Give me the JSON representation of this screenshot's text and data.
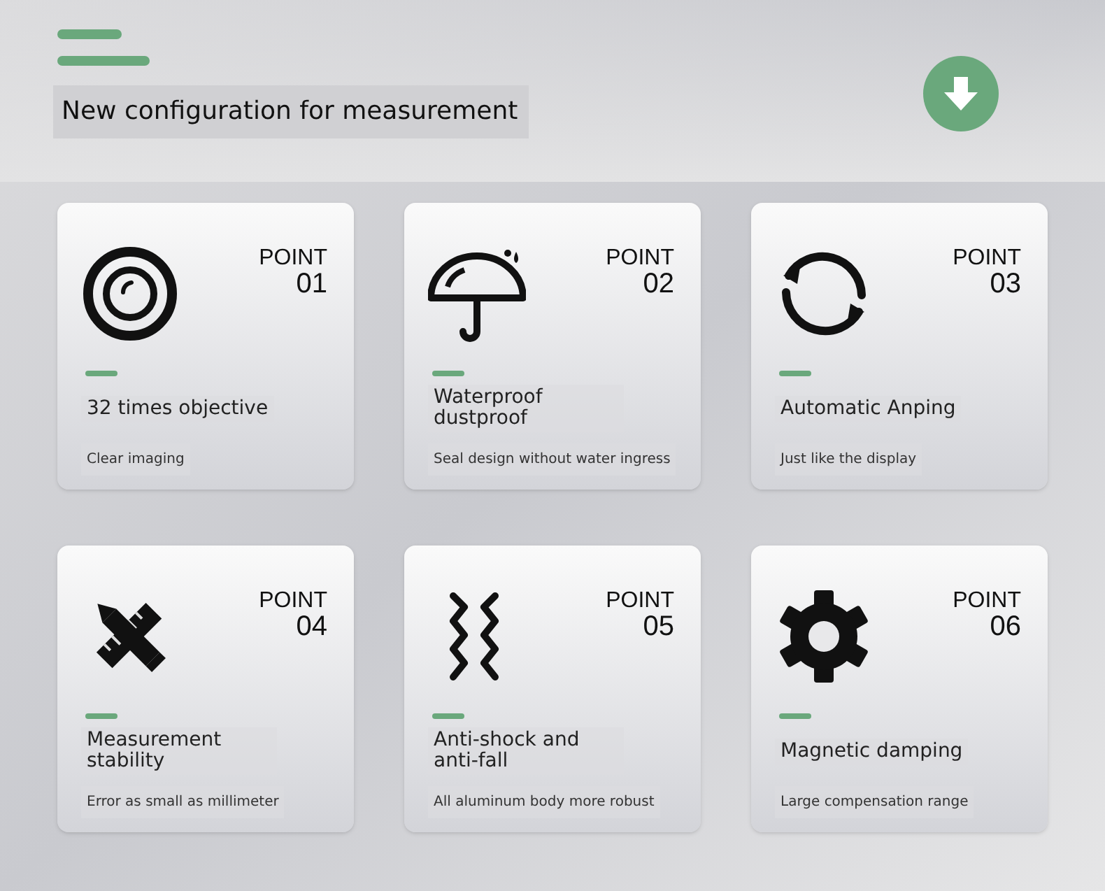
{
  "header": {
    "title": "New configuration for measurement"
  },
  "cards": [
    {
      "label": "POINT",
      "number": "01",
      "title": "32 times objective",
      "subtitle": "Clear imaging"
    },
    {
      "label": "POINT",
      "number": "02",
      "title": "Waterproof dustproof",
      "subtitle": "Seal design without water ingress"
    },
    {
      "label": "POINT",
      "number": "03",
      "title": "Automatic Anping",
      "subtitle": "Just like the display"
    },
    {
      "label": "POINT",
      "number": "04",
      "title": "Measurement stability",
      "subtitle": "Error as small as millimeter"
    },
    {
      "label": "POINT",
      "number": "05",
      "title": "Anti-shock and anti-fall",
      "subtitle": "All aluminum body more robust"
    },
    {
      "label": "POINT",
      "number": "06",
      "title": "Magnetic damping",
      "subtitle": "Large compensation range"
    }
  ]
}
